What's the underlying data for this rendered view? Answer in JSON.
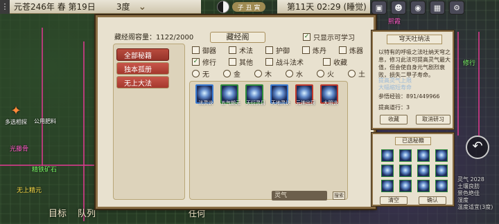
{
  "hud": {
    "date": "元苍246年 春 第19日",
    "temperature": "3度",
    "zodiac": "子 丑 寅",
    "time": "第11天 02:29 (睡觉)",
    "menu_glyph": "⋮"
  },
  "dialog": {
    "title": "藏经阁",
    "capacity": "藏经阁容量：1122/2000",
    "only_learnable": "只显示可学习",
    "close": "×",
    "tabs": [
      "全部秘籍",
      "独本孤册",
      "无上大法"
    ],
    "categories_row1": [
      "御器",
      "术法",
      "护御",
      "炼丹",
      "炼器"
    ],
    "categories_row2": [
      "修行",
      "其他",
      "战斗法术",
      "收藏"
    ],
    "elements": [
      "无",
      "金",
      "木",
      "水",
      "火",
      "土"
    ],
    "skills": [
      "法灵诀",
      "五气朝元",
      "天衍灵目",
      "天地灵诀",
      "元神出窍",
      "大明诀"
    ],
    "search_placeholder": "灵气",
    "search_btn": "搜索"
  },
  "detail": {
    "title": "穹天吐纳法",
    "description": "以特有的呼吸之法吐纳天穹之息，修习此法可提高灵气最大值，但会使自身元气剧烈衰败，损失二甲子寿命。",
    "effect1": "提高灵气上限",
    "effect2": "大幅缩短寿命",
    "exp": "参悟经验：891/449966",
    "dao_line": "提高道行：3",
    "btn_collect": "收藏",
    "btn_cancel": "取消研习"
  },
  "selected": {
    "title": "已选秘籍",
    "btn_clear": "清空",
    "btn_confirm": "确认"
  },
  "bottom": {
    "goal": "目标",
    "team": "队列",
    "task": "任何",
    "search_hint": "搜索"
  },
  "side": {
    "common_seek": "多选相探",
    "public_field": "公用肥料"
  },
  "right_info": {
    "spirit": "灵气 2028",
    "soil": "土壤良肪",
    "scenery": "景色绝佳",
    "dew": "湿度",
    "temp": "温度适宜(3度)"
  },
  "map_labels": {
    "label1": "光藤骨",
    "label2": "精铁矿石",
    "label3": "无上精元",
    "label4": "灵气",
    "label5": "修行",
    "label6": "熙霞"
  },
  "colors": {
    "accent_red": "#b94c3e",
    "frame": "#8a6e45",
    "parchment": "#e8e1cf"
  }
}
